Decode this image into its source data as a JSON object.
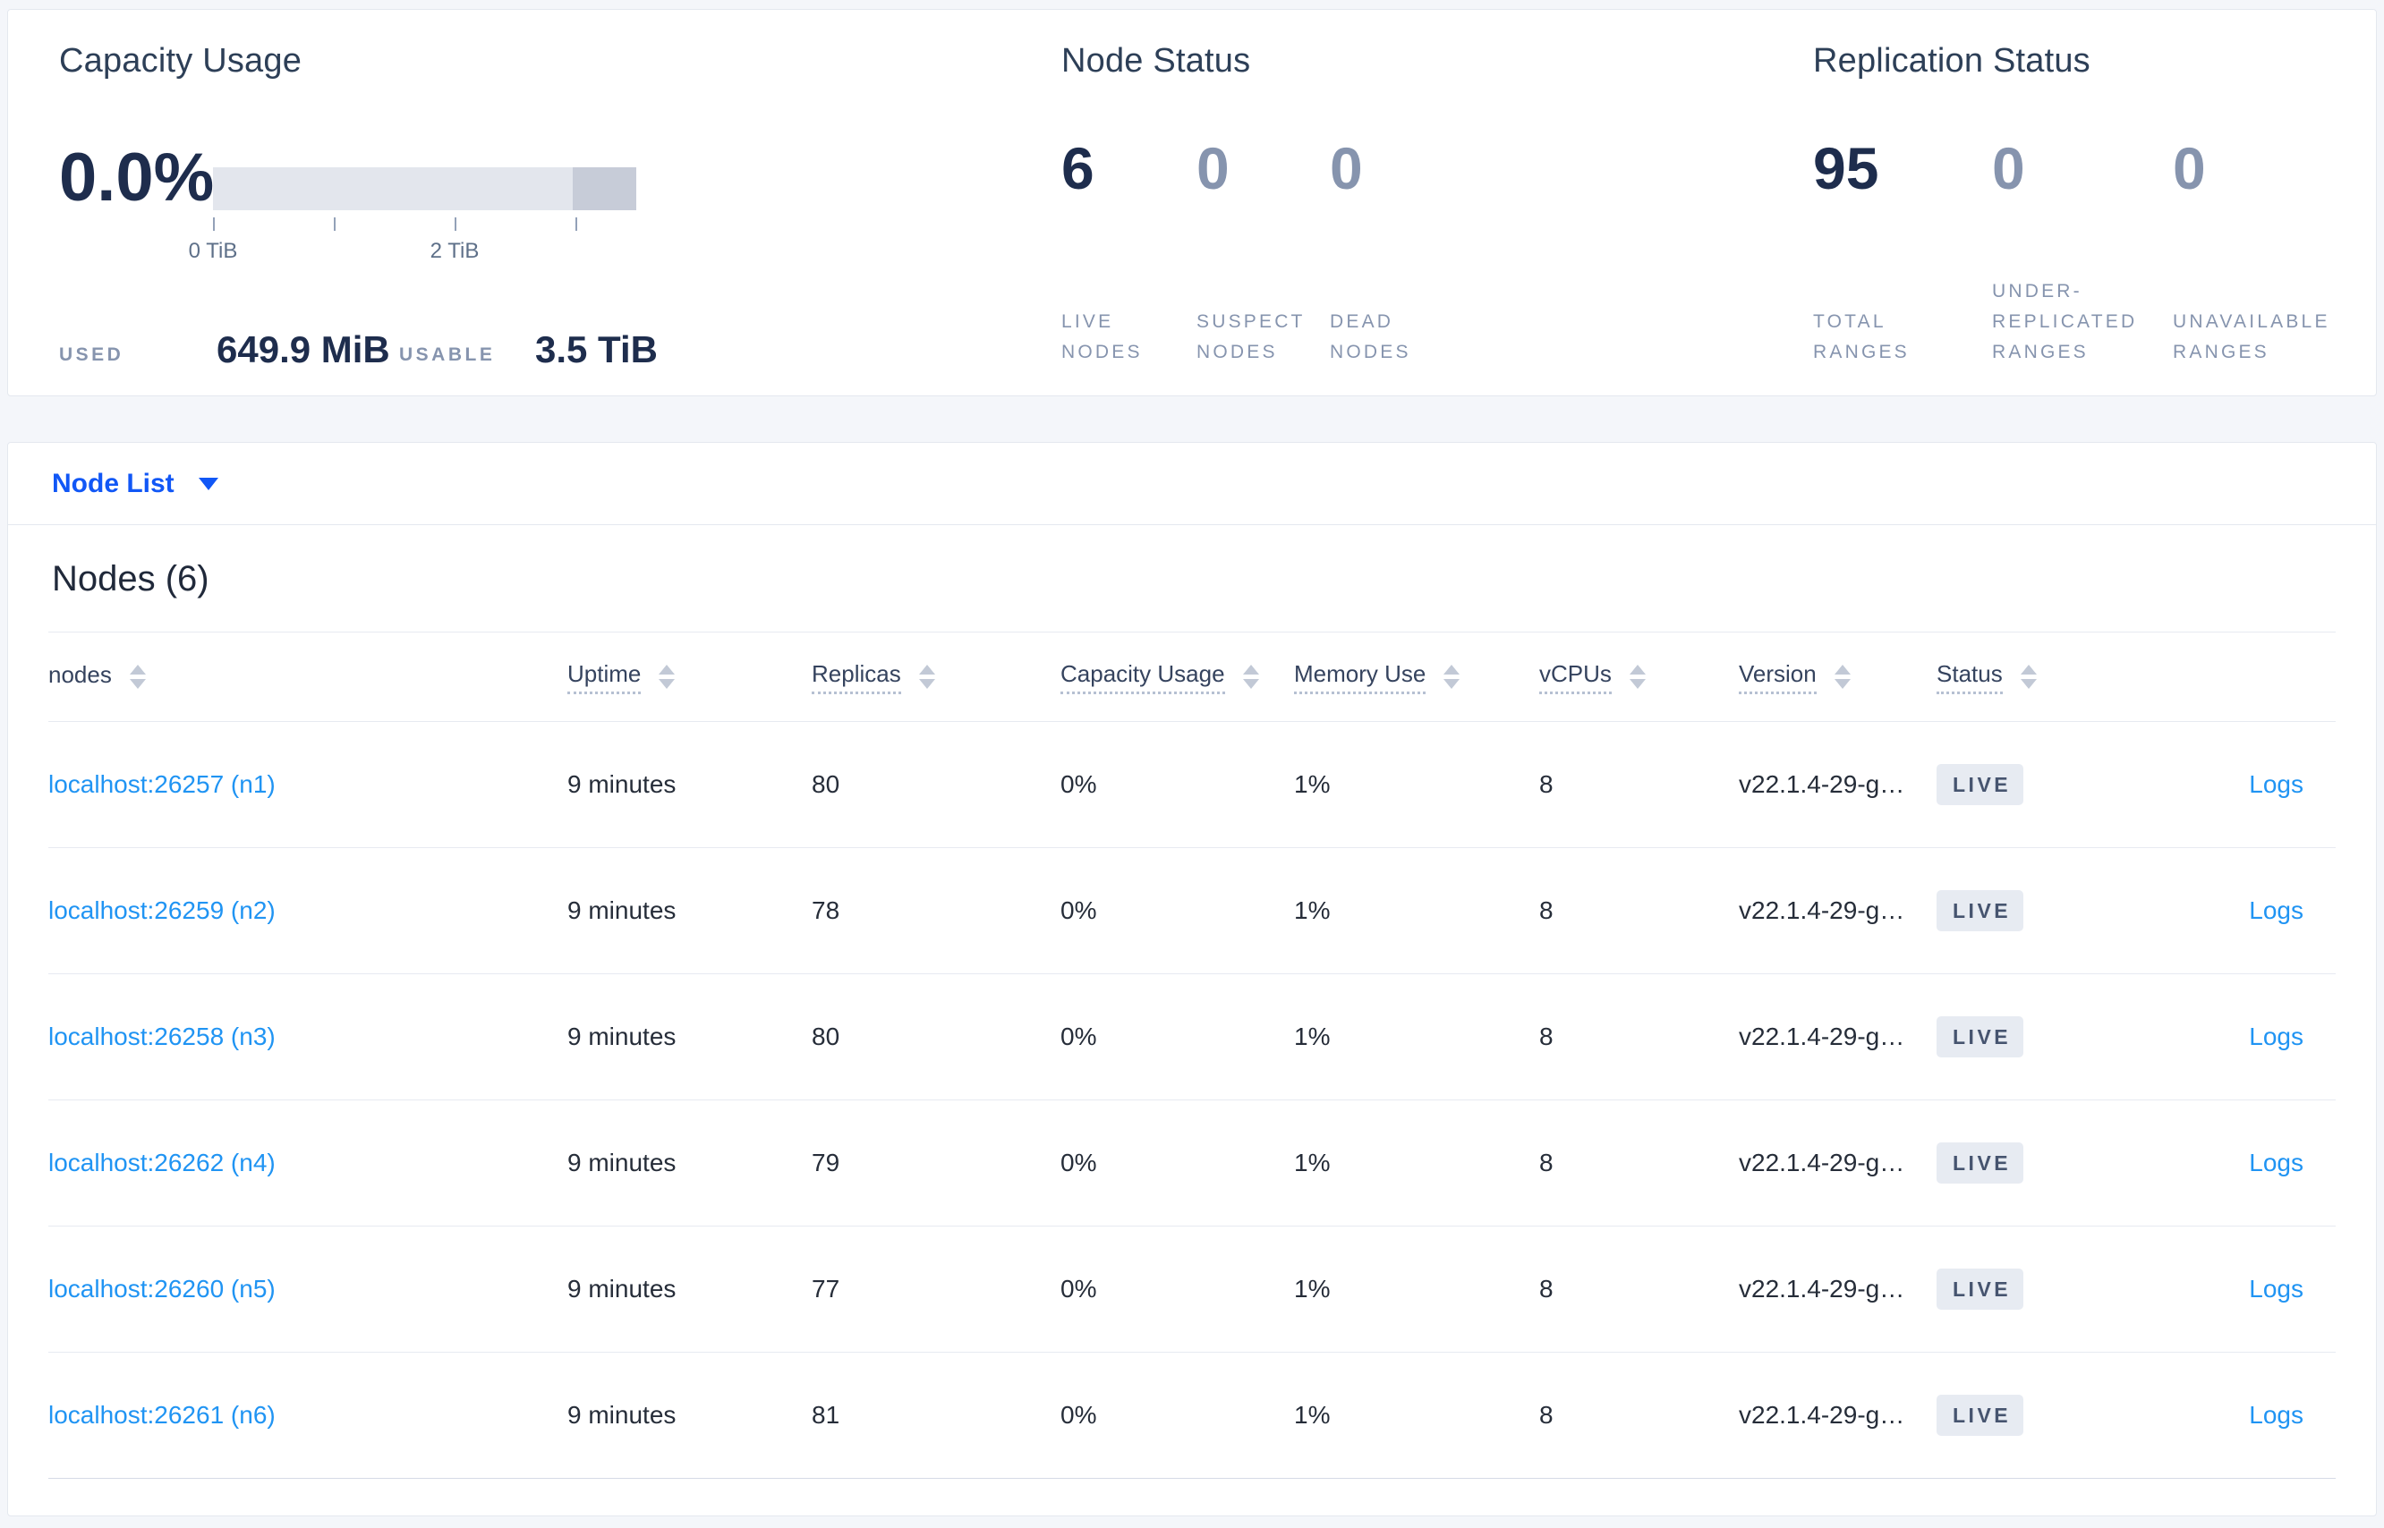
{
  "summary": {
    "capacity_usage": {
      "title": "Capacity Usage",
      "percent_used": "0.0%",
      "bar": {
        "tick_0_label": "0 TiB",
        "tick_2_label": "2 TiB"
      },
      "used_label": "USED",
      "used_value": "649.9 MiB",
      "usable_label": "USABLE",
      "usable_value": "3.5 TiB"
    },
    "node_status": {
      "title": "Node Status",
      "stats": [
        {
          "value": "6",
          "label": "LIVE NODES"
        },
        {
          "value": "0",
          "label": "SUSPECT NODES"
        },
        {
          "value": "0",
          "label": "DEAD NODES"
        }
      ]
    },
    "replication_status": {
      "title": "Replication Status",
      "stats": [
        {
          "value": "95",
          "label": "TOTAL RANGES"
        },
        {
          "value": "0",
          "label": "UNDER-REPLICATED RANGES"
        },
        {
          "value": "0",
          "label": "UNAVAILABLE RANGES"
        }
      ]
    }
  },
  "view_selector": {
    "selected": "Node List"
  },
  "nodes": {
    "title": "Nodes (6)",
    "table": {
      "columns": [
        {
          "label": "nodes"
        },
        {
          "label": "Uptime"
        },
        {
          "label": "Replicas"
        },
        {
          "label": "Capacity Usage"
        },
        {
          "label": "Memory Use"
        },
        {
          "label": "vCPUs"
        },
        {
          "label": "Version"
        },
        {
          "label": "Status"
        },
        {
          "label": ""
        }
      ],
      "rows": [
        {
          "node": "localhost:26257 (n1)",
          "uptime": "9 minutes",
          "replicas": "80",
          "capacity_usage": "0%",
          "memory_use": "1%",
          "vcpus": "8",
          "version": "v22.1.4-29-g…",
          "status": "LIVE",
          "logs": "Logs"
        },
        {
          "node": "localhost:26259 (n2)",
          "uptime": "9 minutes",
          "replicas": "78",
          "capacity_usage": "0%",
          "memory_use": "1%",
          "vcpus": "8",
          "version": "v22.1.4-29-g…",
          "status": "LIVE",
          "logs": "Logs"
        },
        {
          "node": "localhost:26258 (n3)",
          "uptime": "9 minutes",
          "replicas": "80",
          "capacity_usage": "0%",
          "memory_use": "1%",
          "vcpus": "8",
          "version": "v22.1.4-29-g…",
          "status": "LIVE",
          "logs": "Logs"
        },
        {
          "node": "localhost:26262 (n4)",
          "uptime": "9 minutes",
          "replicas": "79",
          "capacity_usage": "0%",
          "memory_use": "1%",
          "vcpus": "8",
          "version": "v22.1.4-29-g…",
          "status": "LIVE",
          "logs": "Logs"
        },
        {
          "node": "localhost:26260 (n5)",
          "uptime": "9 minutes",
          "replicas": "77",
          "capacity_usage": "0%",
          "memory_use": "1%",
          "vcpus": "8",
          "version": "v22.1.4-29-g…",
          "status": "LIVE",
          "logs": "Logs"
        },
        {
          "node": "localhost:26261 (n6)",
          "uptime": "9 minutes",
          "replicas": "81",
          "capacity_usage": "0%",
          "memory_use": "1%",
          "vcpus": "8",
          "version": "v22.1.4-29-g…",
          "status": "LIVE",
          "logs": "Logs"
        }
      ]
    }
  },
  "colors": {
    "accent_blue": "#1157f6",
    "link_blue": "#2094f3",
    "live_badge_bg": "#e7ebf2",
    "live_badge_text": "#46546f",
    "stat_emphasis": "#1e2d4d",
    "stat_muted": "#8694ae"
  }
}
